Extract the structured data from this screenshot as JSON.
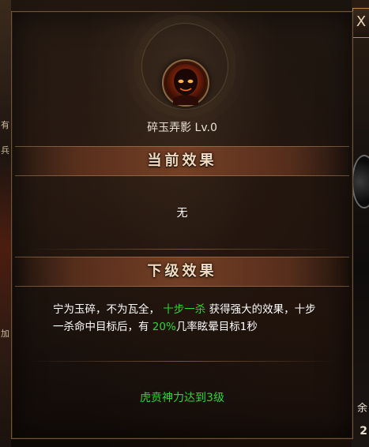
{
  "skill": {
    "name": "碎玉弄影 Lv.0",
    "icon": "demon-face-icon"
  },
  "sections": {
    "current": {
      "title": "当前效果",
      "text": "无"
    },
    "next": {
      "title": "下级效果",
      "desc_part1": "宁为玉碎，不为瓦全，",
      "desc_highlight1": "十步一杀",
      "desc_part2": "获得强大的效果，十步一杀命中目标后，有",
      "desc_highlight2": "20%",
      "desc_part3": "几率眩晕目标1秒"
    }
  },
  "requirement": "虎贲神力达到3级",
  "close_label": "X",
  "background": {
    "right_text_1": "余",
    "right_text_2": "2",
    "left_glyphs": [
      "有",
      "兵",
      "加"
    ]
  },
  "colors": {
    "highlight_green": "#2fd52f",
    "banner_brown": "#783f26",
    "text_white": "#ffffff"
  }
}
